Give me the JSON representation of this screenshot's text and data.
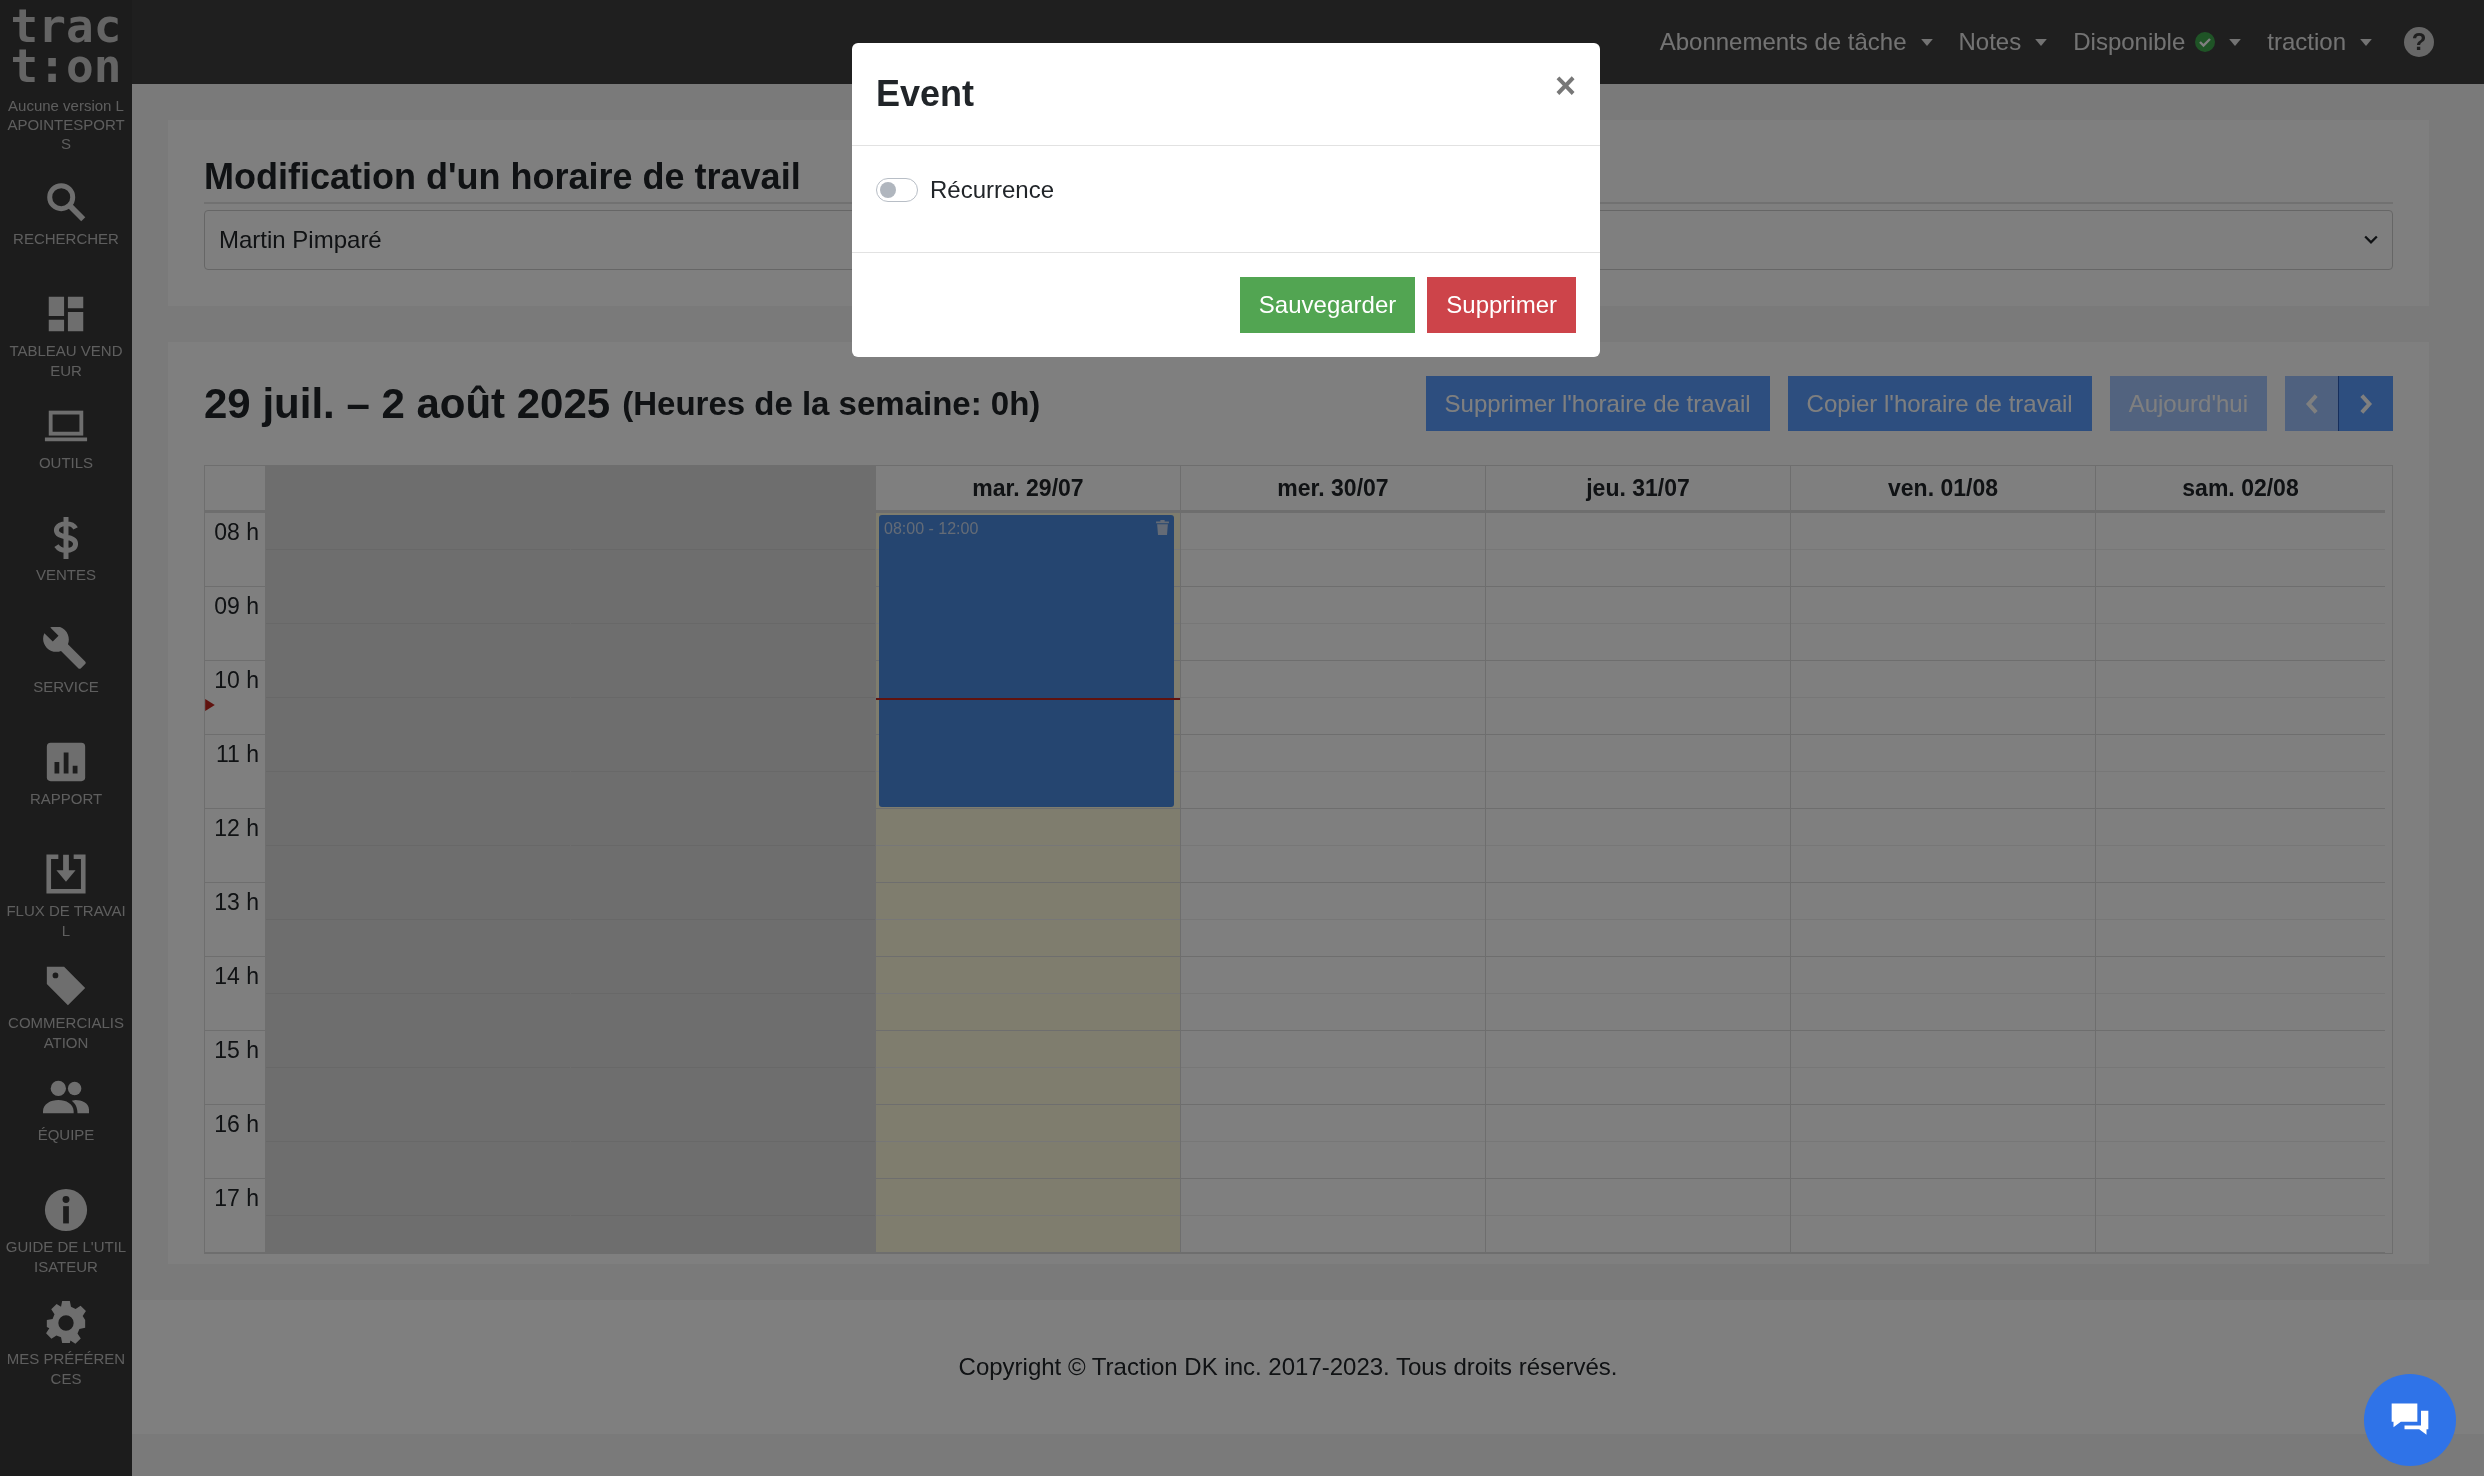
{
  "logo": {
    "line_1": "trac",
    "line_2": "t:on"
  },
  "sidebar": {
    "version_note": "Aucune version LAPOINTESPORTS",
    "items": [
      {
        "label": "RECHERCHER"
      },
      {
        "label": "TABLEAU VENDEUR"
      },
      {
        "label": "OUTILS"
      },
      {
        "label": "VENTES"
      },
      {
        "label": "SERVICE"
      },
      {
        "label": "RAPPORT"
      },
      {
        "label": "FLUX DE TRAVAIL"
      },
      {
        "label": "COMMERCIALISATION"
      },
      {
        "label": "ÉQUIPE"
      },
      {
        "label": "GUIDE DE L'UTILISATEUR"
      },
      {
        "label": "MES PRÉFÉRENCES"
      }
    ]
  },
  "navbar": {
    "items": [
      {
        "label": "Abonnements de tâche",
        "kind": "menu"
      },
      {
        "label": "Notes",
        "kind": "menu"
      },
      {
        "label": "Disponible",
        "kind": "status"
      },
      {
        "label": "traction",
        "kind": "menu"
      }
    ],
    "help": "?"
  },
  "schedule": {
    "title": "Modification d'un horaire de travail",
    "employee": "Martin Pimparé"
  },
  "calendar": {
    "range": "29 juil. – 2 août 2025",
    "week_hours": "(Heures de la semaine: 0h)",
    "buttons": [
      {
        "label": "Supprimer l'horaire de travail",
        "disabled": false
      },
      {
        "label": "Copier l'horaire de travail",
        "disabled": false
      },
      {
        "label": "Aujourd'hui",
        "disabled": true
      }
    ],
    "days": [
      {
        "disabled": true,
        "today": false
      },
      {
        "disabled": true,
        "today": false
      },
      {
        "label": "mar. 29/07",
        "disabled": false,
        "today": true,
        "events": [
          {
            "time": "08:00 - 12:00"
          }
        ]
      },
      {
        "label": "mer. 30/07",
        "disabled": false,
        "today": false
      },
      {
        "label": "jeu. 31/07",
        "disabled": false,
        "today": false
      },
      {
        "label": "ven. 01/08",
        "disabled": false,
        "today": false
      },
      {
        "label": "sam. 02/08",
        "disabled": false,
        "today": false
      }
    ],
    "hours": [
      "08 h",
      "09 h",
      "10 h",
      "11 h",
      "12 h",
      "13 h",
      "14 h",
      "15 h",
      "16 h",
      "17 h"
    ]
  },
  "footer": {
    "copyright": "Copyright © Traction DK inc. 2017-2023. Tous droits réservés."
  },
  "modal": {
    "title": "Event",
    "close": "×",
    "toggle": {
      "label": "Récurrence",
      "on": false
    },
    "buttons": [
      {
        "label": "Sauvegarder",
        "kind": "save"
      },
      {
        "label": "Supprimer",
        "kind": "delete"
      }
    ]
  }
}
